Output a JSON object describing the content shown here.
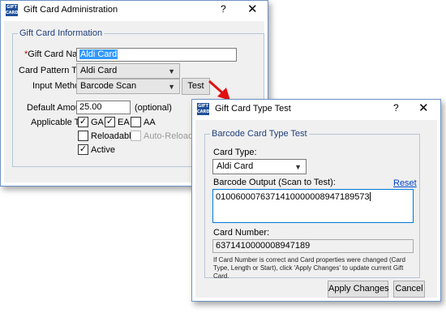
{
  "main_window": {
    "title": "Gift Card Administration",
    "app_icon_text": "GIFT CARD",
    "help_glyph": "?",
    "close_glyph": "✕",
    "group_label": "Gift Card Information",
    "gift_card_name_required": "*",
    "gift_card_name_label": "Gift Card Name:",
    "gift_card_name_value": "Aldi Card",
    "card_pattern_type_label": "Card Pattern Type:",
    "card_pattern_type_value": "Aldi Card",
    "input_method_label": "Input Method:",
    "input_method_value": "Barcode Scan",
    "test_button": "Test",
    "default_amount_label": "Default Amount:",
    "default_amount_value": "25.00",
    "optional_label": "(optional)",
    "applicable_to_label": "Applicable To:",
    "checkboxes": {
      "ga": {
        "label": "GA",
        "checked": true
      },
      "ea": {
        "label": "EA",
        "checked": true
      },
      "aa": {
        "label": "AA",
        "checked": false
      },
      "reloadable": {
        "label": "Reloadable",
        "checked": false
      },
      "auto_reload": {
        "label": "Auto-Reload",
        "checked": false,
        "disabled": true
      },
      "active": {
        "label": "Active",
        "checked": true
      }
    }
  },
  "test_dialog": {
    "title": "Gift Card Type Test",
    "app_icon_text": "GIFT CARD",
    "help_glyph": "?",
    "close_glyph": "✕",
    "group_label": "Barcode Card Type Test",
    "card_type_label": "Card Type:",
    "card_type_value": "Aldi Card",
    "barcode_output_label": "Barcode Output (Scan to Test):",
    "reset_link": "Reset",
    "barcode_output_value": "0100600076371410000008947189573",
    "card_number_label": "Card Number:",
    "card_number_value": "6371410000008947189",
    "note": "If Card Number is correct and Card properties were changed (Card Type, Length or Start), click 'Apply Changes' to update current Gift Card.",
    "apply_button": "Apply Changes",
    "cancel_button": "Cancel"
  },
  "colors": {
    "arrow": "#e01010",
    "group_label": "#1e3e7c",
    "window_border": "#6f93c4",
    "link": "#0044cc"
  },
  "icons": {
    "dropdown": "▼",
    "checkmark": "✓"
  }
}
